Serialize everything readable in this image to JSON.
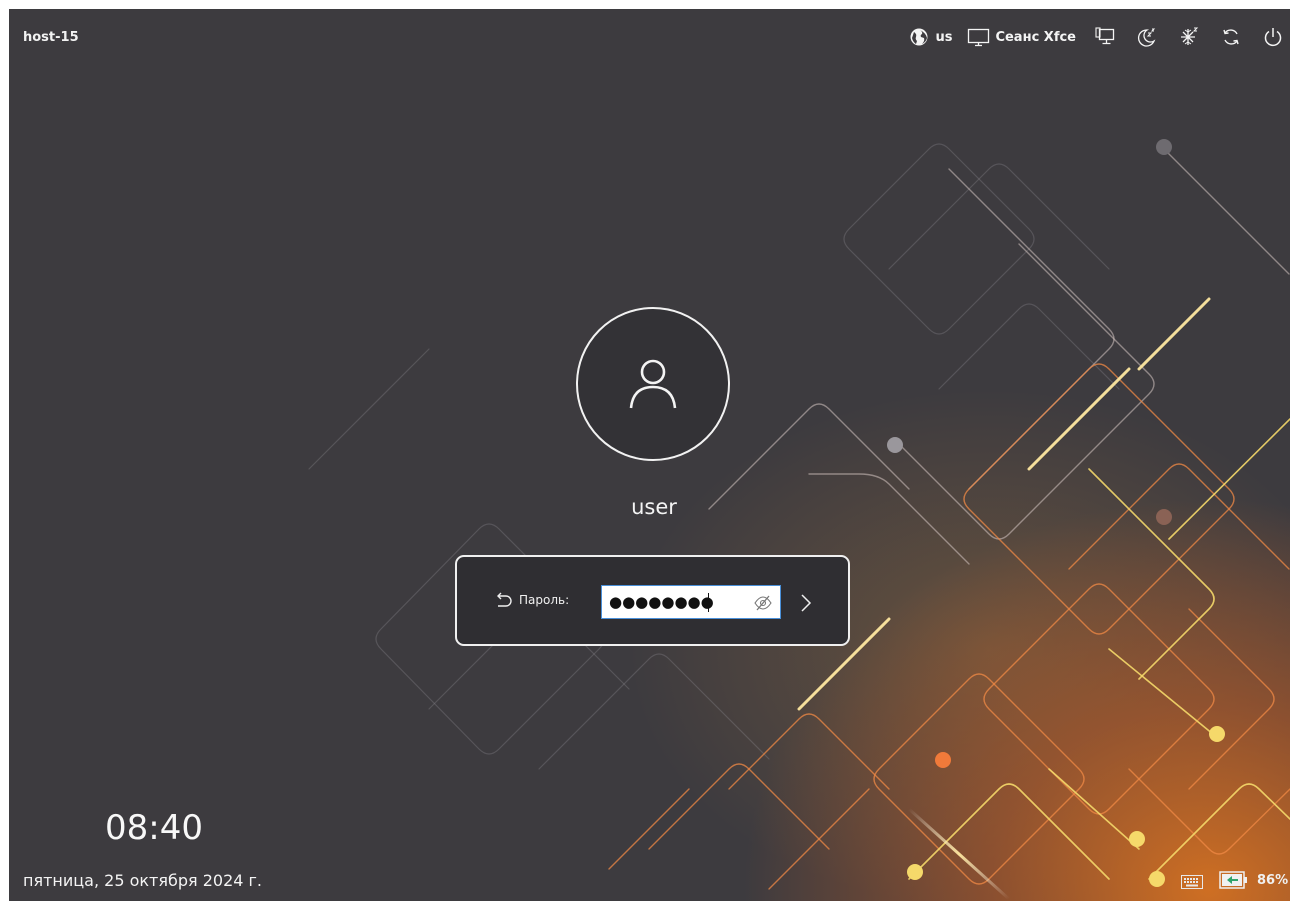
{
  "top_bar": {
    "hostname": "host-15",
    "keyboard_layout": "us",
    "session_label": "Сеанс Xfce",
    "icons": [
      "globe-icon",
      "monitor-icon",
      "network-icon",
      "suspend-icon",
      "hibernate-icon",
      "restart-icon",
      "power-icon"
    ]
  },
  "user": {
    "name": "user",
    "avatar_icon": "user-icon"
  },
  "login": {
    "password_label": "Пароль:",
    "password_value": "●●●●●●●●",
    "back_icon": "undo-icon",
    "visibility_icon": "eye-hidden-icon",
    "submit_icon": "chevron-right-icon"
  },
  "clock": {
    "time": "08:40",
    "date": "пятница, 25 октября 2024 г."
  },
  "status": {
    "keyboard_icon": "keyboard-icon",
    "battery_icon": "battery-charging-icon",
    "battery_level": "86%"
  },
  "colors": {
    "background": "#3d3b3f",
    "accent_orange": "#e8781e",
    "accent_yellow": "#f2d64a",
    "field_border": "#4a90d9"
  }
}
